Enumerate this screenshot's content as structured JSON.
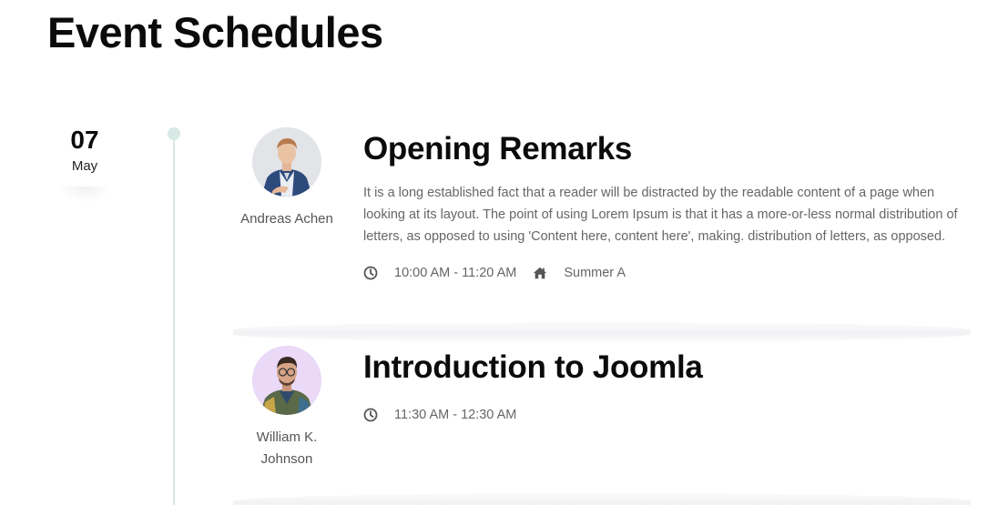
{
  "page": {
    "title": "Event Schedules"
  },
  "date": {
    "day": "07",
    "month": "May"
  },
  "events": [
    {
      "title": "Opening Remarks",
      "speaker": "Andreas Achen",
      "description": "It is a long established fact that a reader will be distracted by the readable content of a page when looking at its layout. The point of using Lorem Ipsum is that it has a more-or-less normal distribution of letters, as opposed to using 'Content here, content here', making. distribution of letters, as opposed.",
      "time": "10:00 AM - 11:20 AM",
      "location": "Summer A",
      "time_icon": "clock-icon",
      "location_icon": "home-icon"
    },
    {
      "title": "Introduction to Joomla",
      "speaker": "William K. Johnson",
      "time": "11:30 AM - 12:30 AM",
      "time_icon": "clock-icon"
    }
  ],
  "colors": {
    "timeline": "#d6e9e4",
    "title_text": "#0b0b0b",
    "body_text": "#666666",
    "avatar_bg_2": "#ead9f7"
  }
}
